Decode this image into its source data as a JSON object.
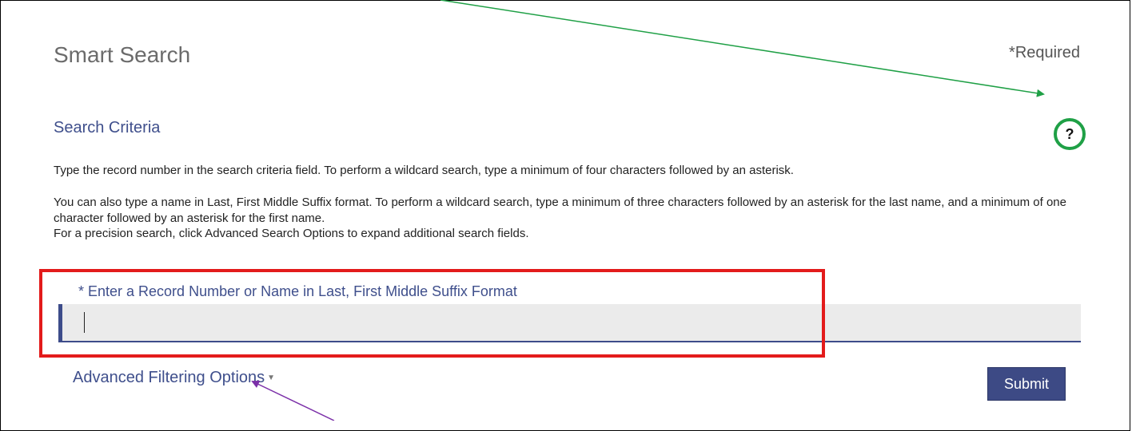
{
  "page": {
    "title": "Smart Search",
    "required_note": "*Required"
  },
  "criteria": {
    "section_title": "Search Criteria",
    "help_label": "?",
    "instruction_1": "Type the record number in the search criteria field. To perform a wildcard search, type a minimum of four characters followed by an asterisk.",
    "instruction_2": "You can also type a name in Last, First Middle Suffix format. To perform a wildcard search, type a minimum of three characters followed by an asterisk for the last name, and a minimum of one character followed by an asterisk for the first name.",
    "instruction_3": "For a precision search, click Advanced Search Options to expand additional search fields."
  },
  "search": {
    "label": "* Enter a Record Number or Name in Last, First Middle Suffix Format",
    "value": ""
  },
  "advanced": {
    "label": "Advanced Filtering Options",
    "caret_icon": "caret-down-icon"
  },
  "actions": {
    "submit_label": "Submit"
  },
  "annotations": {
    "highlight_color": "#e31b1b",
    "help_arrow_color": "#1fa046",
    "advanced_arrow_color": "#7b2fa8"
  }
}
